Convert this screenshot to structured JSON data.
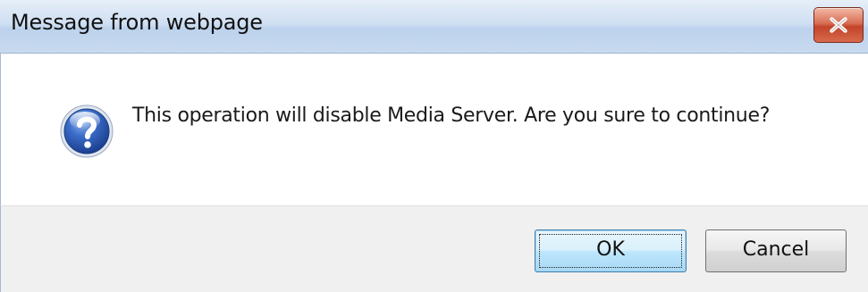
{
  "window": {
    "title": "Message from webpage"
  },
  "titlebar": {
    "close_icon": "close-icon"
  },
  "message": {
    "icon": "question-icon",
    "text": "This operation will disable Media Server. Are you sure to continue?"
  },
  "buttons": {
    "ok_label": "OK",
    "cancel_label": "Cancel"
  },
  "colors": {
    "titlebar": "#cfdff2",
    "close_button": "#c2442a",
    "footer": "#f0f0f0",
    "default_button_border": "#3c7fb1"
  }
}
